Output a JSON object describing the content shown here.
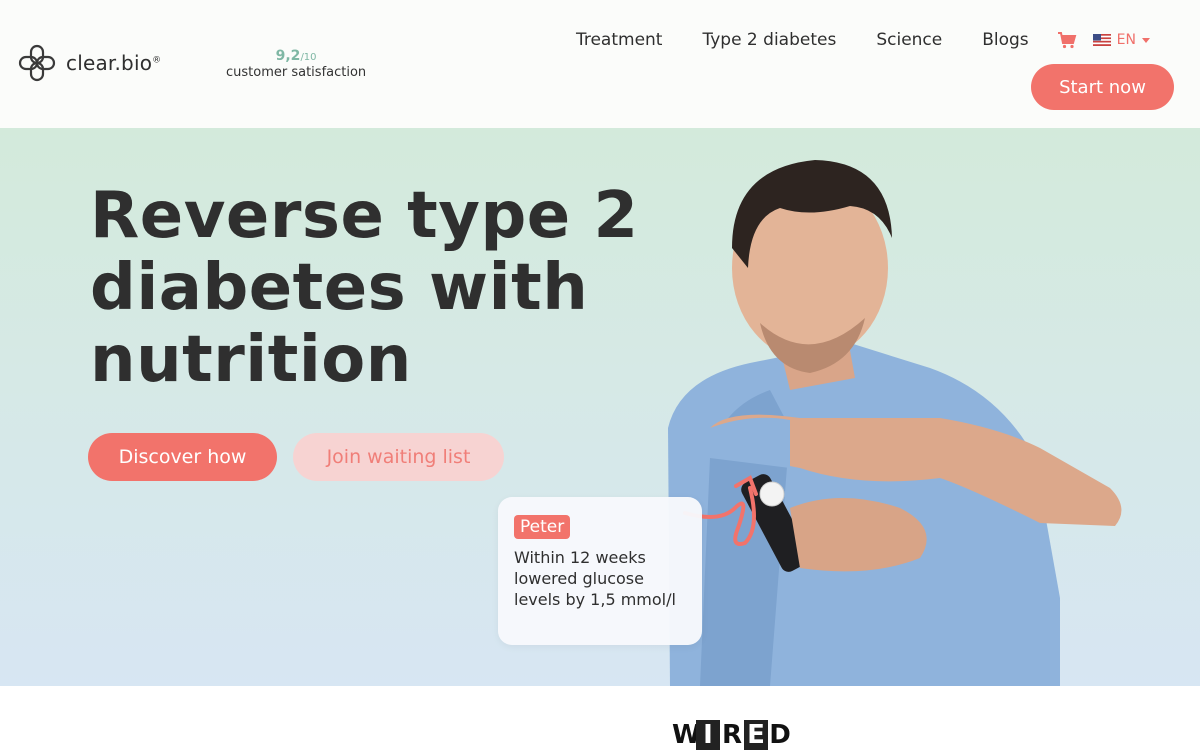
{
  "brand": {
    "name": "clear.bio",
    "mark": "®"
  },
  "rating": {
    "score": "9,2",
    "out_of": "/10",
    "label": "customer satisfaction"
  },
  "nav": {
    "items": [
      "Treatment",
      "Type 2 diabetes",
      "Science",
      "Blogs"
    ],
    "language": "EN",
    "cart_icon": "cart-icon",
    "flag_icon": "us-flag-icon"
  },
  "header": {
    "cta": "Start now"
  },
  "hero": {
    "headline": "Reverse type 2 diabetes with nutrition",
    "primary_cta": "Discover how",
    "secondary_cta": "Join waiting list"
  },
  "testimonial": {
    "name": "Peter",
    "text": "Within 12 weeks lowered glucose levels by 1,5 mmol/l"
  },
  "press": {
    "logo_text": "WIRED"
  },
  "colors": {
    "accent": "#f2736b",
    "accent_light": "#f7d3d2",
    "rating_green": "#7fb7a4",
    "text": "#2f2f2f"
  }
}
